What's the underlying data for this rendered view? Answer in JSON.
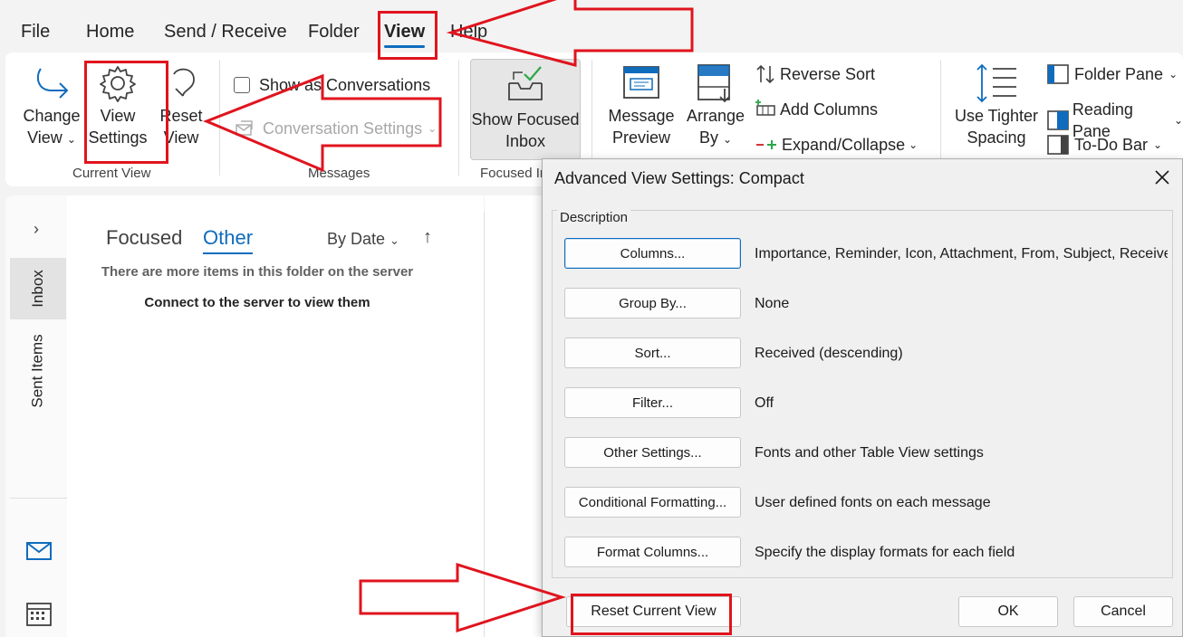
{
  "menu": {
    "tabs": [
      {
        "label": "File"
      },
      {
        "label": "Home"
      },
      {
        "label": "Send / Receive"
      },
      {
        "label": "Folder"
      },
      {
        "label": "View"
      },
      {
        "label": "Help"
      }
    ],
    "active_tab": "View"
  },
  "ribbon": {
    "current_view": {
      "change_view": [
        "Change",
        "View"
      ],
      "view_settings": [
        "View",
        "Settings"
      ],
      "reset_view": [
        "Reset",
        "View"
      ],
      "group_label": "Current View"
    },
    "messages": {
      "show_as_conversations": "Show as Conversations",
      "conversation_settings": "Conversation Settings",
      "group_label": "Messages"
    },
    "focused_inbox": {
      "show_focused_inbox": [
        "Show Focused",
        "Inbox"
      ],
      "group_label": "Focused In"
    },
    "arrangement": {
      "message_preview": [
        "Message",
        "Preview"
      ],
      "arrange_by": [
        "Arrange",
        "By"
      ],
      "reverse_sort": "Reverse Sort",
      "add_columns": "Add Columns",
      "expand_collapse": "Expand/Collapse"
    },
    "spacing": {
      "use_tighter_spacing": [
        "Use Tighter",
        "Spacing"
      ]
    },
    "layout": {
      "folder_pane": "Folder Pane",
      "reading_pane": "Reading Pane",
      "todo_bar": "To-Do Bar"
    }
  },
  "nav": {
    "folders": [
      "Inbox",
      "Sent Items"
    ]
  },
  "message_list": {
    "tabs": [
      "Focused",
      "Other"
    ],
    "active_tab": "Other",
    "sort_label": "By Date",
    "notice_line1": "There are more items in this folder on the server",
    "notice_line2": "Connect to the server to view them"
  },
  "dialog": {
    "title": "Advanced View Settings: Compact",
    "description_label": "Description",
    "rows": [
      {
        "button": "Columns...",
        "description": "Importance, Reminder, Icon, Attachment, From, Subject, Receive..."
      },
      {
        "button": "Group By...",
        "description": "None"
      },
      {
        "button": "Sort...",
        "description": "Received (descending)"
      },
      {
        "button": "Filter...",
        "description": "Off"
      },
      {
        "button": "Other Settings...",
        "description": "Fonts and other Table View settings"
      },
      {
        "button": "Conditional Formatting...",
        "description": "User defined fonts on each message"
      },
      {
        "button": "Format Columns...",
        "description": "Specify the display formats for each field"
      }
    ],
    "reset_button": "Reset Current View",
    "ok_button": "OK",
    "cancel_button": "Cancel"
  },
  "colors": {
    "accent": "#0f6cbd",
    "annotation_red": "#e0141e"
  }
}
